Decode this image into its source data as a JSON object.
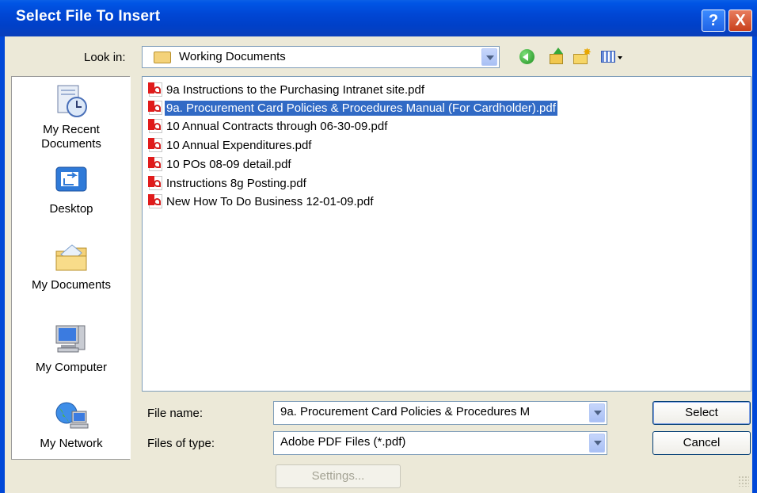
{
  "window": {
    "title": "Select File To Insert",
    "help_label": "?",
    "close_label": "X"
  },
  "lookin": {
    "label": "Look in:",
    "value": "Working Documents"
  },
  "places": [
    {
      "label": "My Recent Documents",
      "icon": "recent-documents-icon"
    },
    {
      "label": "Desktop",
      "icon": "desktop-icon"
    },
    {
      "label": "My Documents",
      "icon": "my-documents-icon"
    },
    {
      "label": "My Computer",
      "icon": "my-computer-icon"
    },
    {
      "label": "My Network",
      "icon": "my-network-icon"
    }
  ],
  "files": [
    {
      "name": "9a Instructions to the Purchasing Intranet site.pdf",
      "selected": false
    },
    {
      "name": "9a. Procurement Card Policies & Procedures Manual (For Cardholder).pdf",
      "selected": true
    },
    {
      "name": "10 Annual Contracts through 06-30-09.pdf",
      "selected": false
    },
    {
      "name": "10 Annual Expenditures.pdf",
      "selected": false
    },
    {
      "name": "10 POs 08-09 detail.pdf",
      "selected": false
    },
    {
      "name": "Instructions 8g Posting.pdf",
      "selected": false
    },
    {
      "name": "New How To Do Business 12-01-09.pdf",
      "selected": false
    }
  ],
  "filename": {
    "label": "File name:",
    "value": "9a. Procurement Card Policies & Procedures M"
  },
  "filetype": {
    "label": "Files of type:",
    "value": "Adobe PDF Files (*.pdf)"
  },
  "buttons": {
    "select": "Select",
    "cancel": "Cancel",
    "settings": "Settings..."
  },
  "colors": {
    "titlebar": "#0046d4",
    "selection": "#316ac5",
    "dialog_bg": "#ece9d8"
  }
}
